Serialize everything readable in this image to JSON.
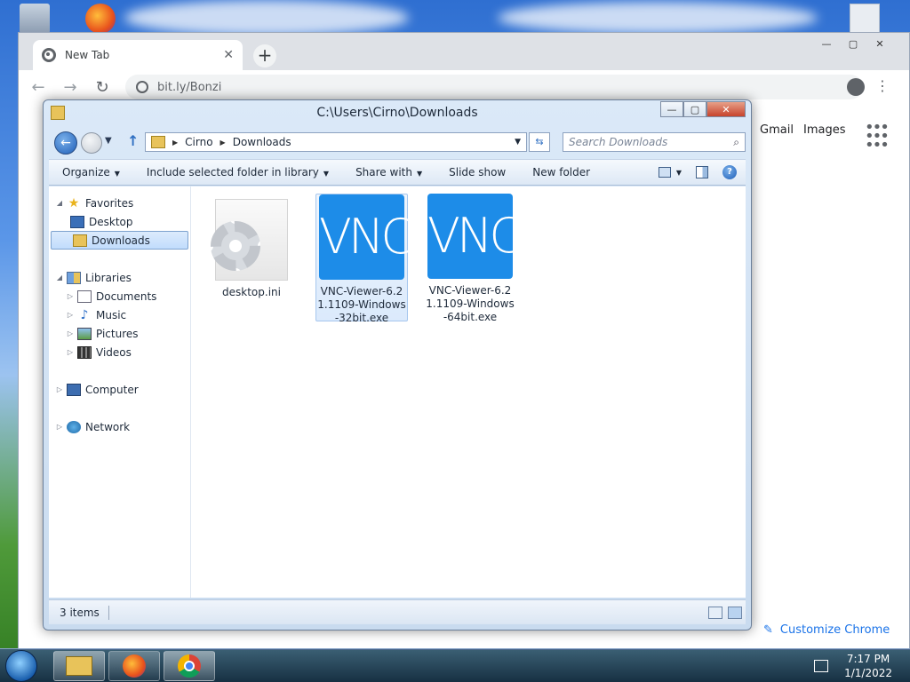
{
  "chrome": {
    "tab_title": "New Tab",
    "tab_close": "✕",
    "new_tab": "+",
    "address": "bit.ly/Bonzi",
    "links": {
      "gmail": "Gmail",
      "images": "Images"
    },
    "customize": "Customize Chrome",
    "window_buttons": {
      "minimize": "—",
      "maximize": "▢",
      "close": "✕"
    }
  },
  "explorer": {
    "title": "C:\\Users\\Cirno\\Downloads",
    "window_buttons": {
      "minimize": "—",
      "maximize": "▢",
      "close": "✕"
    },
    "breadcrumb": [
      "Cirno",
      "Downloads"
    ],
    "search_placeholder": "Search Downloads",
    "commands": [
      "Organize",
      "Include selected folder in library",
      "Share with",
      "Slide show",
      "New folder"
    ],
    "nav": {
      "favorites": "Favorites",
      "desktop": "Desktop",
      "downloads": "Downloads",
      "libraries": "Libraries",
      "documents": "Documents",
      "music": "Music",
      "pictures": "Pictures",
      "videos": "Videos",
      "computer": "Computer",
      "network": "Network"
    },
    "files": [
      {
        "name": "desktop.ini",
        "icon": "settings-file-icon"
      },
      {
        "name": "VNC-Viewer-6.21.1109-Windows-32bit.exe",
        "icon": "vnc-icon",
        "icon_text": "VNC",
        "selected": true
      },
      {
        "name": "VNC-Viewer-6.21.1109-Windows-64bit.exe",
        "icon": "vnc-icon",
        "icon_text": "VNC"
      }
    ],
    "status": "3 items"
  },
  "taskbar": {
    "time": "7:17 PM",
    "date": "1/1/2022"
  },
  "colors": {
    "vnc_blue": "#1d8ce8",
    "selection": "#c1dcfc",
    "chrome_link": "#1a73e8"
  }
}
